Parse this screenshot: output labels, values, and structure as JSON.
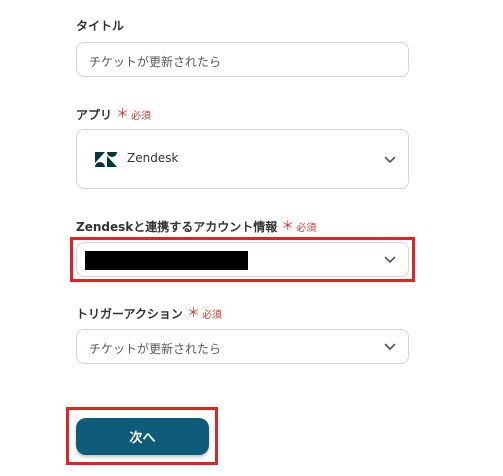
{
  "title_field": {
    "label": "タイトル",
    "value": "チケットが更新されたら"
  },
  "app_field": {
    "label": "アプリ",
    "required_mark": "＊",
    "required_text": "必須",
    "selected_app": "Zendesk",
    "icon": "zendesk-logo"
  },
  "account_field": {
    "label": "Zendeskと連携するアカウント情報",
    "required_mark": "＊",
    "required_text": "必須",
    "value_redacted": true
  },
  "trigger_field": {
    "label": "トリガーアクション",
    "required_mark": "＊",
    "required_text": "必須",
    "selected": "チケットが更新されたら"
  },
  "next_button": {
    "label": "次へ"
  },
  "colors": {
    "primary_button": "#0e5c79",
    "required": "#e0342f",
    "highlight_box": "#e02424",
    "zendesk_logo": "#03363d"
  }
}
